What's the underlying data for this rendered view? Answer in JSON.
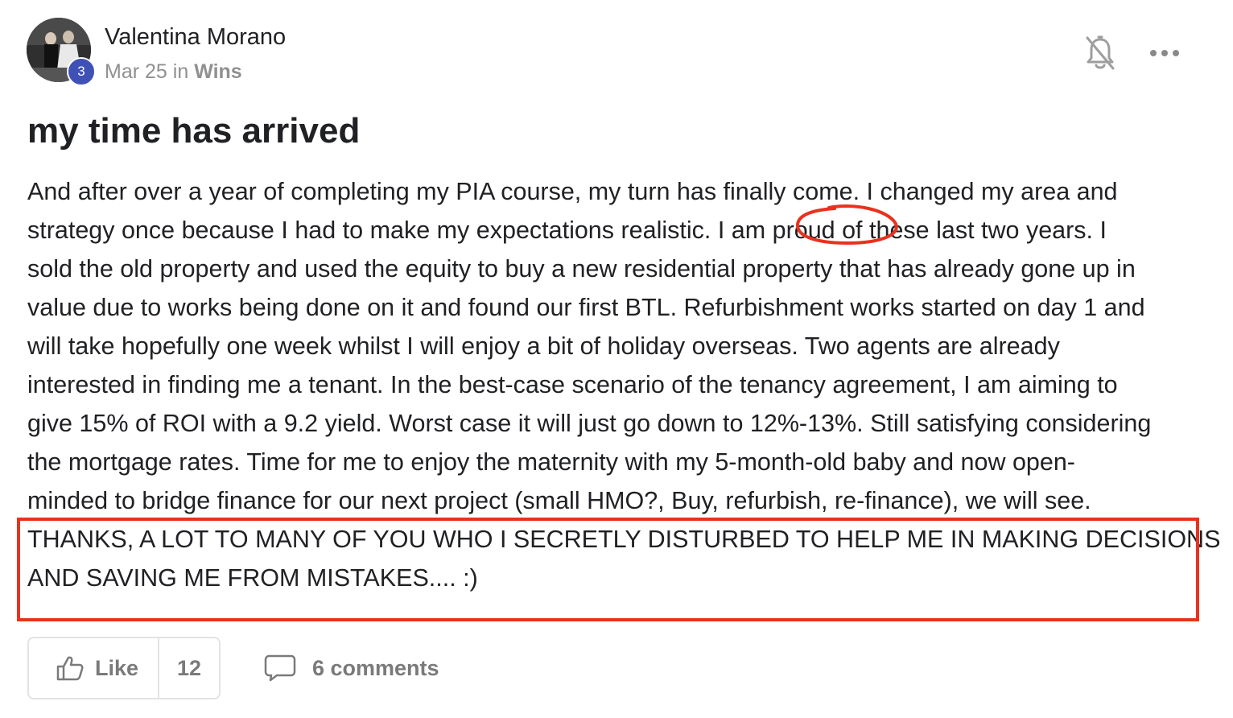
{
  "post": {
    "author": {
      "name": "Valentina Morano",
      "level": "3"
    },
    "date": "Mar 25",
    "in_label": "in",
    "category": "Wins",
    "title": "my time has arrived",
    "body_lines": [
      "And after over a year of completing my PIA course, my turn has finally come. I changed my area and",
      "strategy once because I had to make my expectations realistic. I am proud of these last two years. I",
      "sold the old property and used the equity to buy a new residential property that has already gone up in",
      "value due to works being done on it and found our first BTL. Refurbishment works started on day 1 and",
      "will take hopefully one week whilst I will enjoy a bit of holiday overseas. Two agents are already",
      "interested in finding me a tenant. In the best-case scenario of the tenancy agreement, I am aiming to",
      "give 15% of ROI with a 9.2 yield. Worst case it will just go down to 12%-13%. Still satisfying considering",
      "the mortgage rates. Time for me to enjoy the maternity with my 5-month-old baby and now open-",
      "minded to bridge finance for our next project (small HMO?, Buy, refurbish, re-finance), we will see.",
      "THANKS, A LOT TO MANY OF YOU WHO I SECRETLY DISTURBED TO HELP ME IN MAKING DECISIONS",
      "AND SAVING ME FROM MISTAKES.... :)"
    ]
  },
  "actions": {
    "like_label": "Like",
    "like_count": "12",
    "comments_label": "6 comments"
  },
  "icons": {
    "notification": "bell-off-icon",
    "menu": "more-horizontal-icon",
    "like": "thumbs-up-icon",
    "comment": "comment-icon"
  },
  "colors": {
    "badge": "#3f51b5",
    "annotation": "#e8321f",
    "muted_text": "#909090"
  }
}
